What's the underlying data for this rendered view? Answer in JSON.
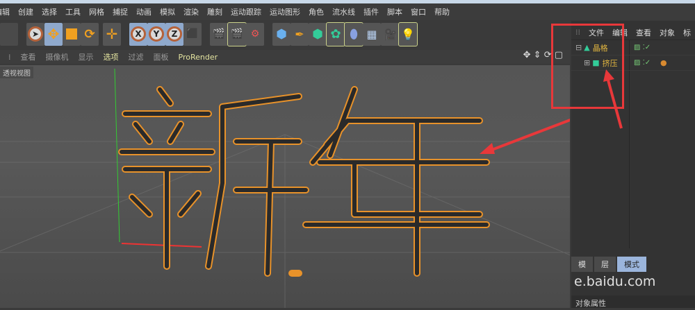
{
  "menu": [
    "编辑",
    "创建",
    "选择",
    "工具",
    "网格",
    "捕捉",
    "动画",
    "模拟",
    "渲染",
    "雕刻",
    "运动跟踪",
    "运动图形",
    "角色",
    "流水线",
    "插件",
    "脚本",
    "窗口",
    "帮助"
  ],
  "toolbar": {
    "axes": [
      "X",
      "Y",
      "Z"
    ]
  },
  "viewport_menu": [
    "查看",
    "摄像机",
    "显示",
    "选项",
    "过滤",
    "面板",
    "ProRender"
  ],
  "viewport_label": "透视视图",
  "objects_panel": {
    "menu": [
      "文件",
      "编辑",
      "查看",
      "对象",
      "标"
    ],
    "items": [
      {
        "name": "晶格"
      },
      {
        "name": "挤压"
      }
    ]
  },
  "attributes": {
    "tabs": [
      "模",
      "层",
      "模式"
    ],
    "title": "对象属性"
  },
  "watermark": "e.baidu.com",
  "colors": {
    "accent": "#e2b640",
    "highlight": "#e8383a",
    "selected": "#8fa9cc"
  }
}
